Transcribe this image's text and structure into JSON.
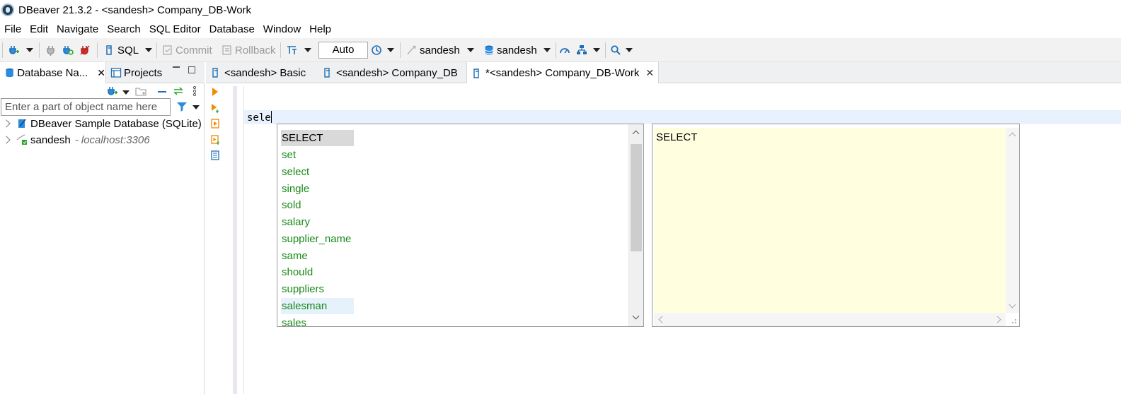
{
  "window": {
    "title": "DBeaver 21.3.2 - <sandesh> Company_DB-Work"
  },
  "menu": [
    "File",
    "Edit",
    "Navigate",
    "Search",
    "SQL Editor",
    "Database",
    "Window",
    "Help"
  ],
  "toolbar": {
    "sql_label": "SQL",
    "commit_label": "Commit",
    "rollback_label": "Rollback",
    "transaction_mode": "Auto",
    "datasource_label": "sandesh",
    "schema_label": "sandesh"
  },
  "left_panel": {
    "tab_db_navigator": "Database Na...",
    "tab_projects": "Projects",
    "filter_placeholder": "Enter a part of object name here",
    "tree": [
      {
        "label": "DBeaver Sample Database (SQLite)",
        "host": ""
      },
      {
        "label": "sandesh",
        "host": "- localhost:3306"
      }
    ]
  },
  "editor": {
    "tabs": [
      "<sandesh> Basic",
      "<sandesh> Company_DB",
      "*<sandesh> Company_DB-Work"
    ],
    "active_tab": 2,
    "code": "sele"
  },
  "autocomplete": {
    "items": [
      "SELECT",
      "set",
      "select",
      "single",
      "sold",
      "salary",
      "supplier_name",
      "same",
      "should",
      "suppliers",
      "salesman",
      "sales"
    ],
    "selected_index": 0,
    "hovered_index": 10,
    "info_text": "SELECT"
  },
  "colors": {
    "keyword_green": "#1a8a1a",
    "info_background": "#ffffe0",
    "current_line": "#e8f2fe",
    "toolbar_bg": "#f2f2f2"
  }
}
